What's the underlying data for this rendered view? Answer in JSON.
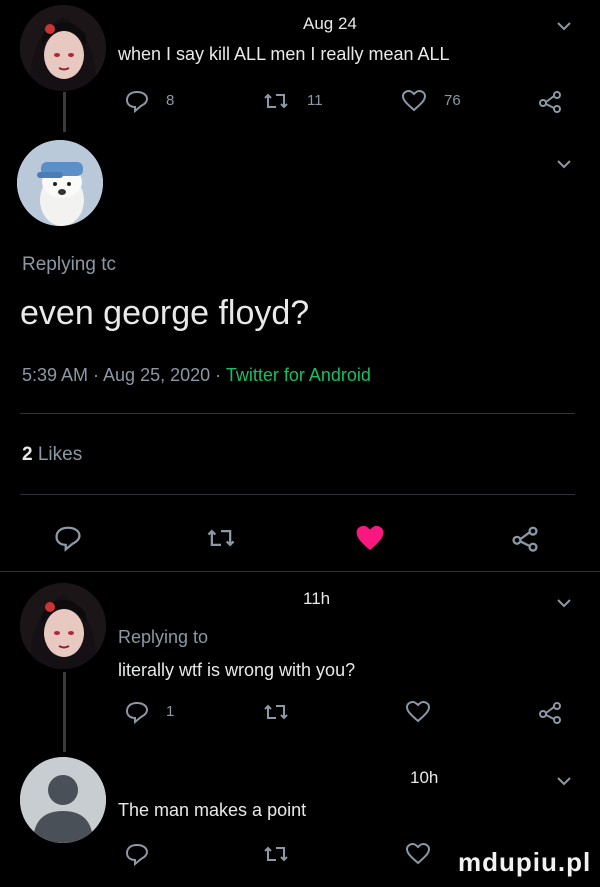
{
  "tweet1": {
    "time": "Aug 24",
    "text": "when I say kill ALL men I really mean ALL",
    "reply_count": "8",
    "retweet_count": "11",
    "like_count": "76"
  },
  "main_tweet": {
    "replying_to": "Replying tc",
    "text": "even george floyd?",
    "timestamp": "5:39 AM · Aug 25, 2020 · ",
    "source": "Twitter for Android",
    "likes_number": "2",
    "likes_label": "Likes",
    "like_color": "#f91880",
    "link_color": "#17bf63"
  },
  "reply1": {
    "time": "11h",
    "replying_to": "Replying to",
    "text": "literally wtf is wrong with you?",
    "reply_count": "1"
  },
  "reply2": {
    "time": "10h",
    "text": "The man makes a point"
  },
  "watermark": "mdupiu.pl"
}
